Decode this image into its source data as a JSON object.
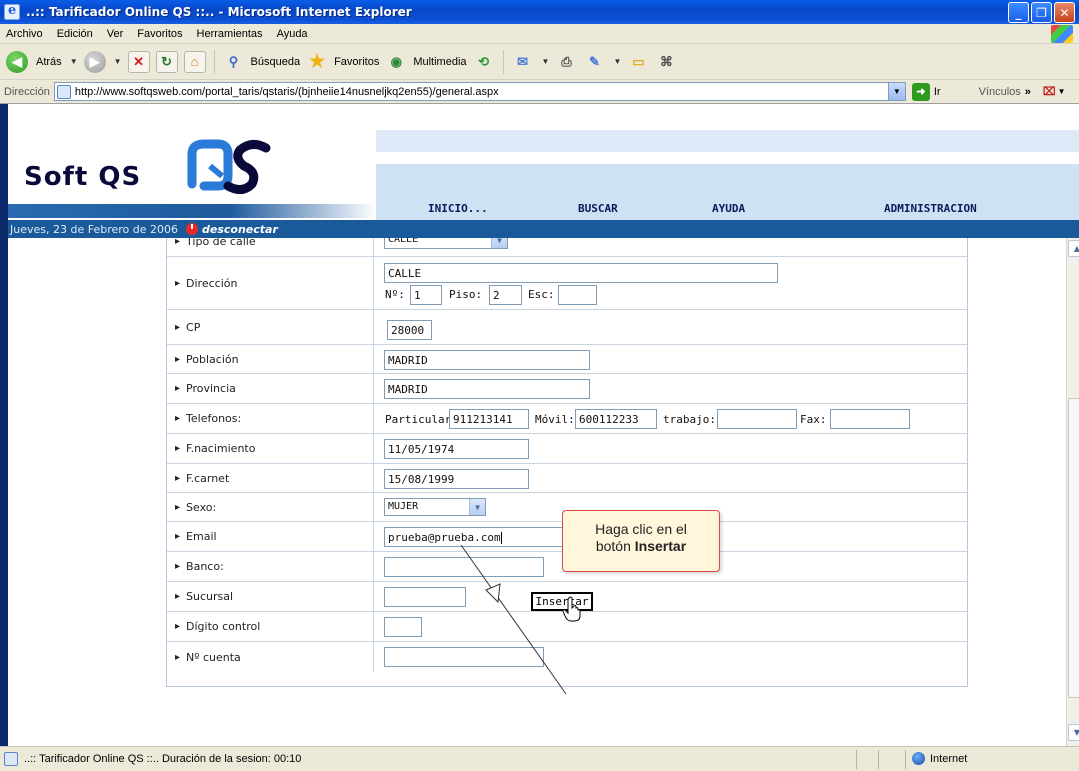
{
  "window": {
    "title": "..:: Tarificador Online QS ::.. - Microsoft Internet Explorer",
    "controls": [
      "_",
      "❐",
      "✕"
    ]
  },
  "menubar": [
    "Archivo",
    "Edición",
    "Ver",
    "Favoritos",
    "Herramientas",
    "Ayuda"
  ],
  "toolbar": {
    "back_label": "Atrás",
    "search_label": "Búsqueda",
    "favorites_label": "Favoritos",
    "multimedia_label": "Multimedia"
  },
  "address": {
    "label": "Dirección",
    "url": "http://www.softqsweb.com/portal_taris/qstaris/(bjnheiie14nusneljkq2en55)/general.aspx",
    "go_label": "Ir",
    "links_label": "Vínculos"
  },
  "site": {
    "logo_text": "Soft QS",
    "nav": [
      "INICIO...",
      "BUSCAR",
      "AYUDA",
      "ADMINISTRACION"
    ],
    "date_text": "Jueves, 23 de Febrero de 2006",
    "disconnect_label": "desconectar"
  },
  "form": {
    "tipo_calle": {
      "label": "Tipo de calle",
      "value": "CALLE"
    },
    "direccion": {
      "label": "Dirección",
      "value": "CALLE",
      "num_label": "Nº:",
      "num_value": "1",
      "piso_label": "Piso:",
      "piso_value": "2",
      "esc_label": "Esc:",
      "esc_value": ""
    },
    "cp": {
      "label": "CP",
      "value": "28000"
    },
    "poblacion": {
      "label": "Población",
      "value": "MADRID"
    },
    "provincia": {
      "label": "Provincia",
      "value": "MADRID"
    },
    "telefonos": {
      "label": "Telefonos:",
      "particular_label": "Particular:",
      "particular_value": "911213141",
      "movil_label": "Móvil:",
      "movil_value": "600112233",
      "trabajo_label": "trabajo:",
      "trabajo_value": "",
      "fax_label": "Fax:",
      "fax_value": ""
    },
    "f_nacimiento": {
      "label": "F.nacimiento",
      "value": "11/05/1974"
    },
    "f_carnet": {
      "label": "F.carnet",
      "value": "15/08/1999"
    },
    "sexo": {
      "label": "Sexo:",
      "value": "MUJER"
    },
    "email": {
      "label": "Email",
      "value": "prueba@prueba.com"
    },
    "banco": {
      "label": "Banco:",
      "value": ""
    },
    "sucursal": {
      "label": "Sucursal",
      "value": ""
    },
    "digito_control": {
      "label": "Dígito control",
      "value": ""
    },
    "num_cuenta": {
      "label": "Nº cuenta",
      "value": ""
    },
    "insert_label": "Insertar"
  },
  "callout": {
    "line1": "Haga clic en el",
    "line2_prefix": "botón ",
    "line2_bold": "Insertar"
  },
  "statusbar": {
    "text": "..:: Tarificador Online QS ::.. Duración de la sesion: 00:10",
    "zone": "Internet"
  }
}
